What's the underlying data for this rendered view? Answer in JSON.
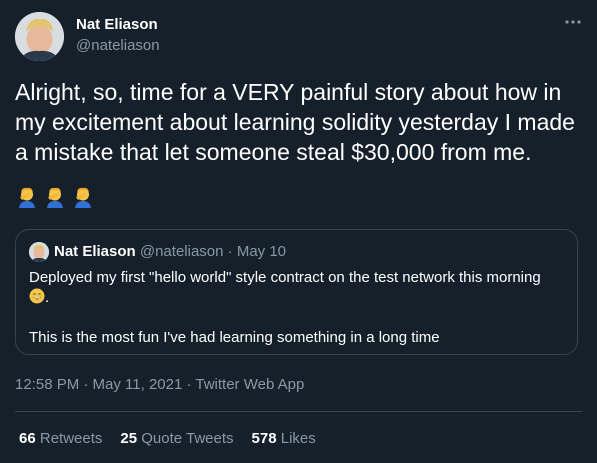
{
  "author": {
    "name": "Nat Eliason",
    "handle": "@nateliason"
  },
  "tweet": {
    "text": "Alright, so, time for a VERY painful story about how in my excitement about learning solidity yesterday I made a mistake that let someone steal $30,000 from me.",
    "emojis": [
      "man-facepalming-emoji",
      "man-facepalming-emoji",
      "man-facepalming-emoji"
    ]
  },
  "quoted_tweet": {
    "name": "Nat Eliason",
    "handle": "@nateliason",
    "separator": "·",
    "date": "May 10",
    "line1": "Deployed my first \"hello world\" style contract on the test network this morning",
    "line1_suffix": ".",
    "line2": "This is the most fun I've had learning something in a long time"
  },
  "meta": {
    "timestamp": "12:58 PM · May 11, 2021 · Twitter Web App"
  },
  "stats": {
    "retweets_count": "66",
    "retweets_label": "Retweets",
    "quotes_count": "25",
    "quotes_label": "Quote Tweets",
    "likes_count": "578",
    "likes_label": "Likes"
  },
  "colors": {
    "background": "#15202b",
    "text_primary": "#ffffff",
    "text_secondary": "#8899a6",
    "border": "#38444d"
  }
}
